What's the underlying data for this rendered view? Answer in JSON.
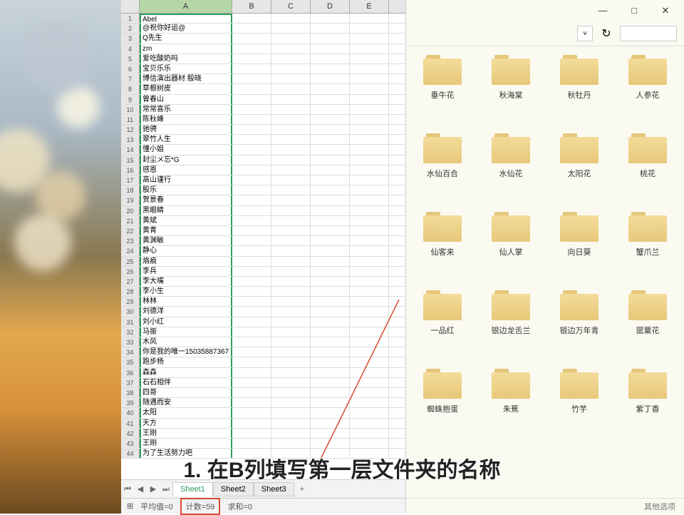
{
  "spreadsheet": {
    "columns": [
      "A",
      "B",
      "C",
      "D",
      "E"
    ],
    "selected_column": "A",
    "rows": [
      "Abel",
      "@祝你好运@",
      "Q先生",
      "zm",
      "爱吃酸奶吗",
      "宝贝乐乐",
      "博信演出器材 殷晓",
      "草根树皮",
      "曾春山",
      "常常喜乐",
      "陈秋峰",
      "驰骋",
      "翠竹人生",
      "懂小姐",
      "封尘メ忘*G",
      "感恩",
      "高山谨行",
      "股乐",
      "贺景春",
      "黑眼睛",
      "黄斌",
      "黄青",
      "黄渊敏",
      "静心",
      "烙痕",
      "李兵",
      "李大嘴",
      "李小生",
      "林林",
      "刘德洋",
      "刘小红",
      "马振",
      "木风",
      "你是我的唯一15035887367",
      "跑步杨",
      "森森",
      "石石相伴",
      "四哥",
      "随遇而安",
      "太阳",
      "天方",
      "王刚",
      "王刚",
      "为了生活努力吧"
    ],
    "tabs": [
      "Sheet1",
      "Sheet2",
      "Sheet3"
    ],
    "active_tab": "Sheet1",
    "status": {
      "avg_label": "平均值=0",
      "count_label": "计数=59",
      "sum_label": "求和=0"
    }
  },
  "explorer": {
    "window_buttons": {
      "min": "—",
      "max": "□",
      "close": "✕"
    },
    "folders": [
      "垂牛花",
      "秋海棠",
      "秋牡丹",
      "人参花",
      "水仙百合",
      "水仙花",
      "太阳花",
      "桃花",
      "仙客来",
      "仙人掌",
      "向日葵",
      "蟹爪兰",
      "一品红",
      "银边龙舌兰",
      "银边万年青",
      "罂粟花",
      "蜘蛛抱蛋",
      "朱蕉",
      "竹芋",
      "紫丁香"
    ],
    "status_text": "其他选项"
  },
  "overlay": {
    "text": "1. 在B列填写第一层文件夹的名称"
  }
}
